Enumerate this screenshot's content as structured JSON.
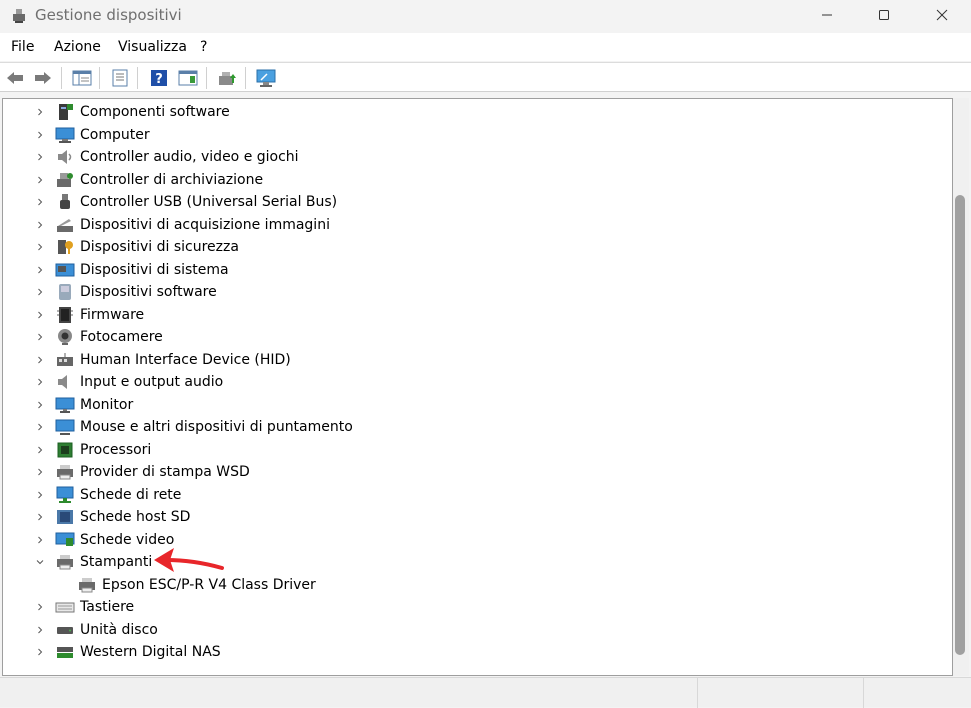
{
  "window": {
    "title": "Gestione dispositivi"
  },
  "menu": [
    "File",
    "Azione",
    "Visualizza",
    "?"
  ],
  "toolbar": [
    "back-icon",
    "forward-icon",
    "properties-pane-icon",
    "properties-icon",
    "help-icon",
    "action-pane-icon",
    "update-driver-icon",
    "scan-hardware-icon"
  ],
  "tree": [
    {
      "label": "Componenti software",
      "icon": "software-component-icon",
      "expanded": false
    },
    {
      "label": "Computer",
      "icon": "computer-icon",
      "expanded": false
    },
    {
      "label": "Controller audio, video e giochi",
      "icon": "speaker-icon",
      "expanded": false
    },
    {
      "label": "Controller di archiviazione",
      "icon": "storage-controller-icon",
      "expanded": false
    },
    {
      "label": "Controller USB (Universal Serial Bus)",
      "icon": "usb-icon",
      "expanded": false
    },
    {
      "label": "Dispositivi di acquisizione immagini",
      "icon": "scanner-icon",
      "expanded": false
    },
    {
      "label": "Dispositivi di sicurezza",
      "icon": "security-device-icon",
      "expanded": false
    },
    {
      "label": "Dispositivi di sistema",
      "icon": "system-device-icon",
      "expanded": false
    },
    {
      "label": "Dispositivi software",
      "icon": "software-device-icon",
      "expanded": false
    },
    {
      "label": "Firmware",
      "icon": "firmware-icon",
      "expanded": false
    },
    {
      "label": "Fotocamere",
      "icon": "camera-icon",
      "expanded": false
    },
    {
      "label": "Human Interface Device (HID)",
      "icon": "hid-icon",
      "expanded": false
    },
    {
      "label": "Input e output audio",
      "icon": "audio-io-icon",
      "expanded": false
    },
    {
      "label": "Monitor",
      "icon": "monitor-icon",
      "expanded": false
    },
    {
      "label": "Mouse e altri dispositivi di puntamento",
      "icon": "mouse-icon",
      "expanded": false
    },
    {
      "label": "Processori",
      "icon": "processor-icon",
      "expanded": false
    },
    {
      "label": "Provider di stampa WSD",
      "icon": "printer-icon",
      "expanded": false
    },
    {
      "label": "Schede di rete",
      "icon": "network-adapter-icon",
      "expanded": false
    },
    {
      "label": "Schede host SD",
      "icon": "sd-host-icon",
      "expanded": false
    },
    {
      "label": "Schede video",
      "icon": "display-adapter-icon",
      "expanded": false
    },
    {
      "label": "Stampanti",
      "icon": "printer-icon",
      "expanded": true
    },
    {
      "label": "Epson ESC/P-R V4 Class Driver",
      "icon": "printer-icon",
      "child": true
    },
    {
      "label": "Tastiere",
      "icon": "keyboard-icon",
      "expanded": false
    },
    {
      "label": "Unità disco",
      "icon": "disk-drive-icon",
      "expanded": false
    },
    {
      "label": "Western Digital NAS",
      "icon": "nas-icon",
      "expanded": false
    }
  ],
  "annotation_color": "#e8262a"
}
